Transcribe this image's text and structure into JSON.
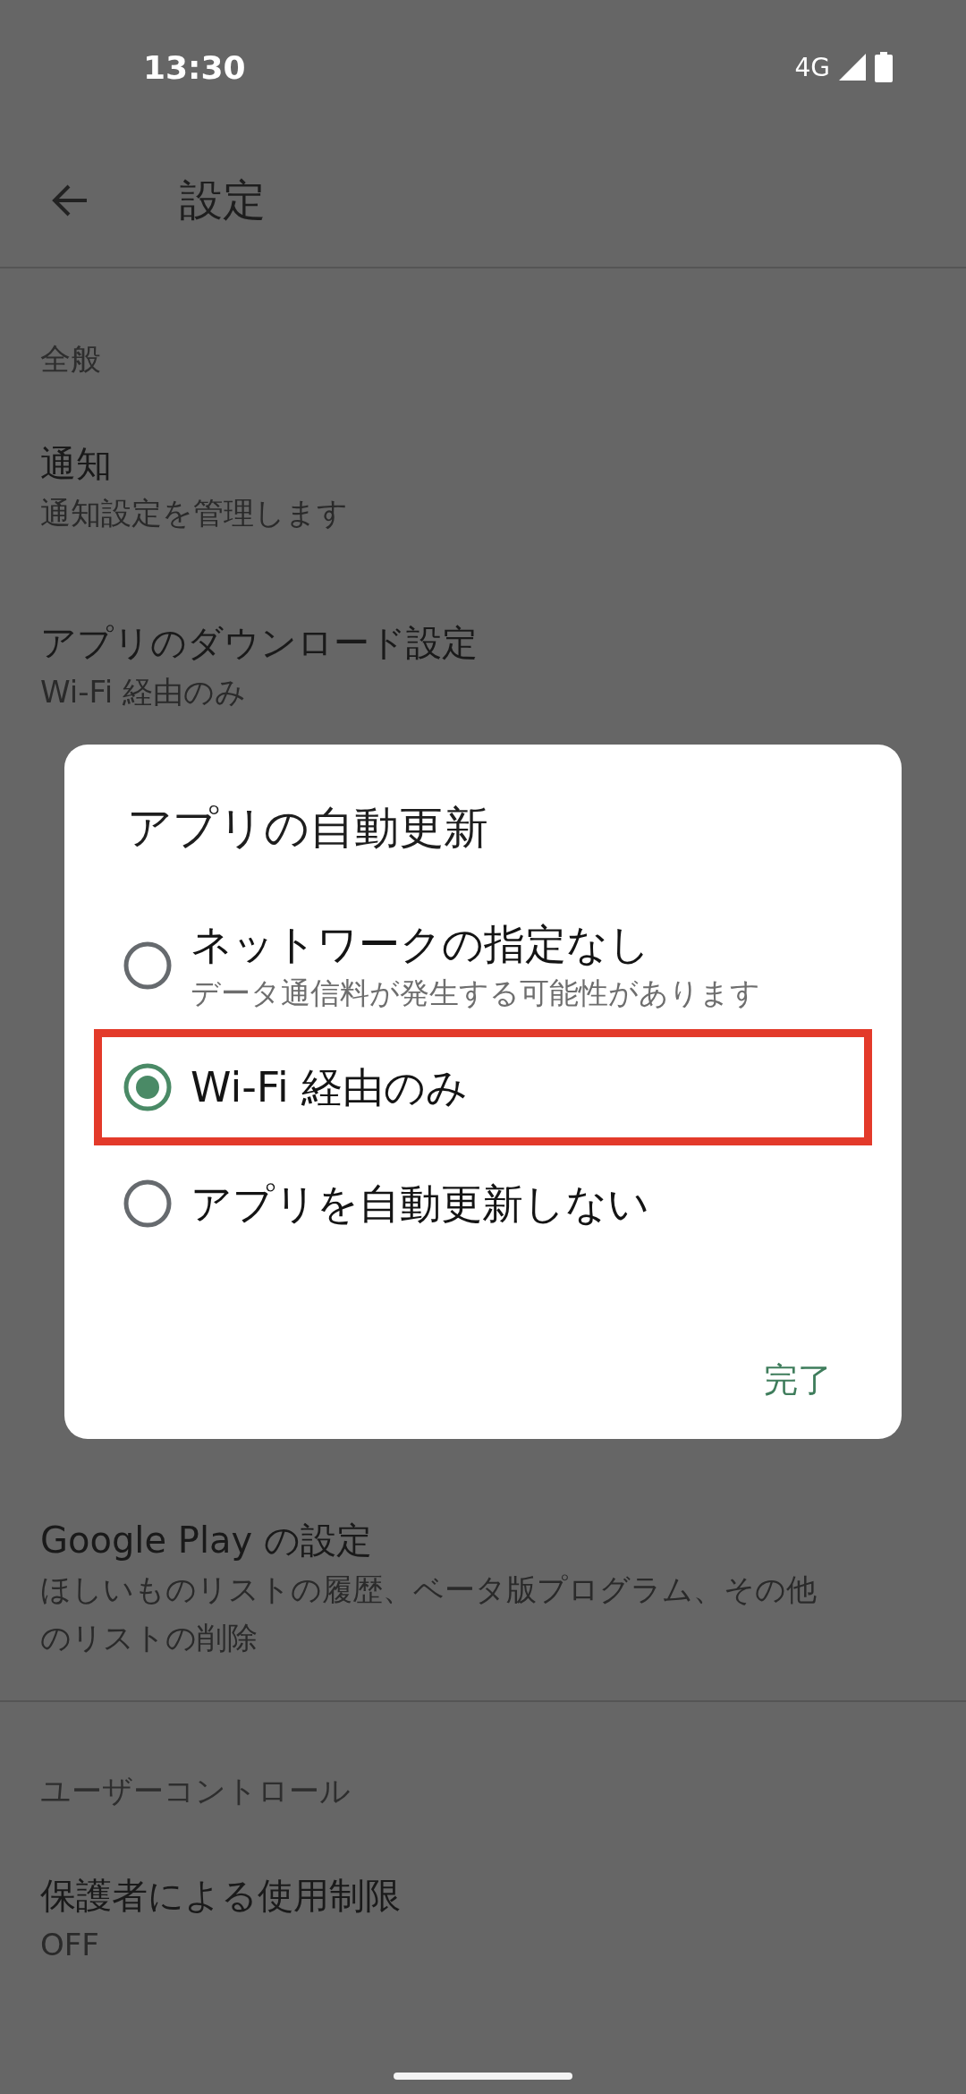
{
  "status_bar": {
    "time": "13:30",
    "network": "4G"
  },
  "header": {
    "title": "設定"
  },
  "sections": [
    {
      "heading": "全般",
      "items": [
        {
          "title": "通知",
          "subtitle": [
            "通知設定を管理します"
          ]
        },
        {
          "title": "アプリのダウンロード設定",
          "subtitle": [
            "Wi-Fi 経由のみ"
          ]
        },
        {
          "title": "Google Play の設定",
          "subtitle": [
            "ほしいものリストの履歴、ベータ版プログラム、その他",
            "のリストの削除"
          ]
        }
      ]
    },
    {
      "heading": "ユーザーコントロール",
      "items": [
        {
          "title": "保護者による使用制限",
          "subtitle": [
            "OFF"
          ]
        }
      ]
    }
  ],
  "dialog": {
    "title": "アプリの自動更新",
    "options": [
      {
        "label": "ネットワークの指定なし",
        "description": "データ通信料が発生する可能性があります",
        "selected": false,
        "highlighted": false
      },
      {
        "label": "Wi-Fi 経由のみ",
        "selected": true,
        "highlighted": true
      },
      {
        "label": "アプリを自動更新しない",
        "selected": false,
        "highlighted": false
      }
    ],
    "button": "完了"
  }
}
